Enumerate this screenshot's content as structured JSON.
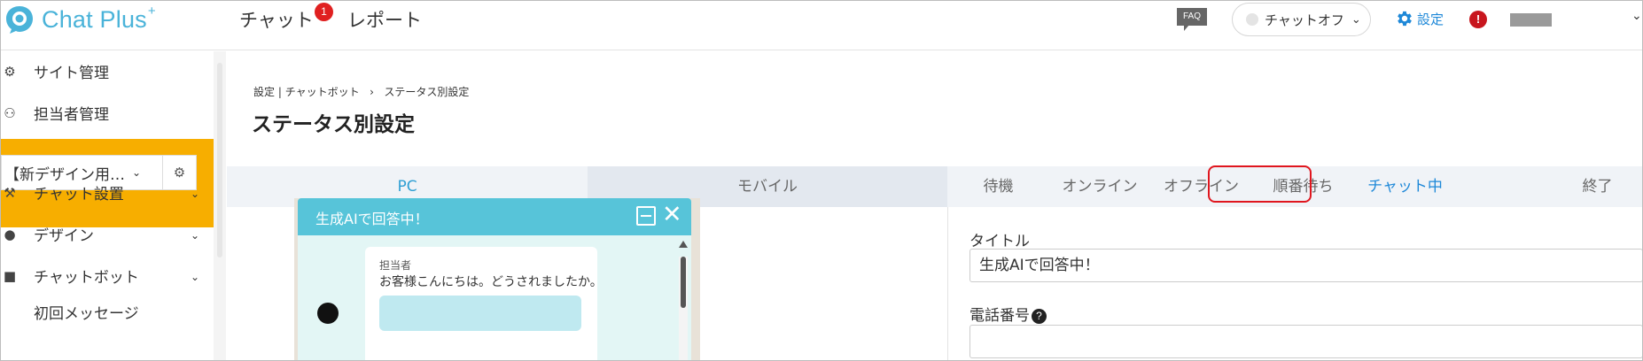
{
  "header": {
    "logo_text": "Chat Plus",
    "logo_sup": "+",
    "nav": {
      "chat_label": "チャット",
      "chat_badge": "1",
      "report_label": "レポート"
    },
    "faq_label": "FAQ",
    "status_selector": {
      "value": "チャットオフ"
    },
    "settings_label": "設定",
    "alert_label": "!"
  },
  "sidebar": {
    "items": [
      {
        "label": "サイト管理",
        "icon": "gears-icon"
      },
      {
        "label": "担当者管理",
        "icon": "users-gear-icon"
      }
    ],
    "site_selector": {
      "value": "【新デザイン用…"
    },
    "menu": [
      {
        "label": "チャット設置",
        "icon": "tools-icon"
      },
      {
        "label": "デザイン",
        "icon": "palette-icon"
      },
      {
        "label": "チャットボット",
        "icon": "chat-bubbles-icon"
      }
    ],
    "sub_items": [
      {
        "label": "初回メッセージ"
      }
    ]
  },
  "main": {
    "breadcrumb": {
      "part1": "設定",
      "sep1": "|",
      "part2": "チャットボット",
      "sep2": "›",
      "current": "ステータス別設定"
    },
    "page_title": "ステータス別設定",
    "device_tabs": {
      "pc": "PC",
      "mobile": "モバイル",
      "active": "PC"
    },
    "status_tabs": {
      "items": [
        "待機",
        "オンライン",
        "オフライン",
        "順番待ち",
        "チャット中",
        "終了"
      ],
      "active": "チャット中"
    },
    "form": {
      "title_label": "タイトル",
      "title_value": "生成AIで回答中！",
      "phone_label": "電話番号",
      "phone_value": "",
      "help_icon": "?"
    },
    "preview": {
      "title": "生成AIで回答中！",
      "close_glyph": "✕",
      "operator_name": "担当者",
      "message": "お客様こんにちは。どうされましたか。"
    }
  },
  "colors": {
    "accent": "#1e88d8",
    "brand": "#4ab3d9",
    "sidebar_highlight": "#f7ae00",
    "chat_header": "#57c4d9",
    "badge_red": "#e02020",
    "active_tab_outline": "#e0161e"
  }
}
